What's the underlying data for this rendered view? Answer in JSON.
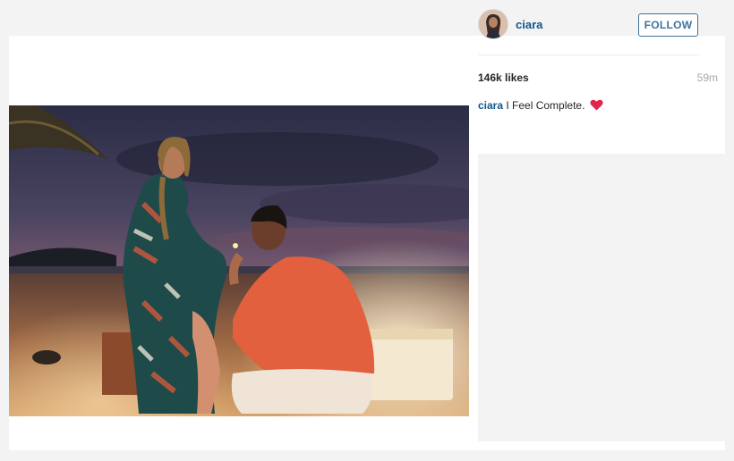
{
  "post": {
    "username": "ciara",
    "follow_label": "FOLLOW",
    "likes": "146k likes",
    "time_ago": "59m",
    "caption_user": "ciara",
    "caption_text": "I Feel Complete.",
    "caption_emoji": "heart-icon"
  },
  "colors": {
    "link": "#125688",
    "follow_border": "#3f729b",
    "heart": "#e0244b"
  }
}
